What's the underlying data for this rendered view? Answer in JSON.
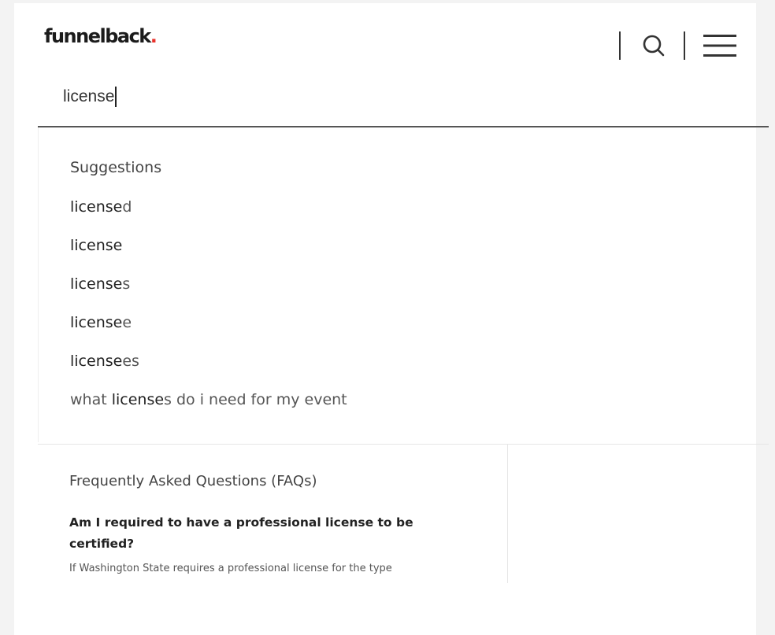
{
  "brand": {
    "name": "funnelback",
    "dot": ".",
    "dot_color": "#e8322b"
  },
  "header": {
    "search_icon": "search-icon",
    "menu_icon": "hamburger-menu-icon"
  },
  "search": {
    "value": "license"
  },
  "suggestions": {
    "heading": "Suggestions",
    "items": [
      {
        "match": "license",
        "rest_before": "",
        "rest_after": "d"
      },
      {
        "match": "license",
        "rest_before": "",
        "rest_after": ""
      },
      {
        "match": "license",
        "rest_before": "",
        "rest_after": "s"
      },
      {
        "match": "license",
        "rest_before": "",
        "rest_after": "e"
      },
      {
        "match": "license",
        "rest_before": "",
        "rest_after": "es"
      },
      {
        "match": "license",
        "rest_before": "what ",
        "rest_after": "s do i need for my event"
      }
    ]
  },
  "faq": {
    "heading": "Frequently Asked Questions (FAQs)",
    "question": "Am I required to have a professional license to be certified?",
    "excerpt": "If Washington State requires a professional license for the type"
  }
}
